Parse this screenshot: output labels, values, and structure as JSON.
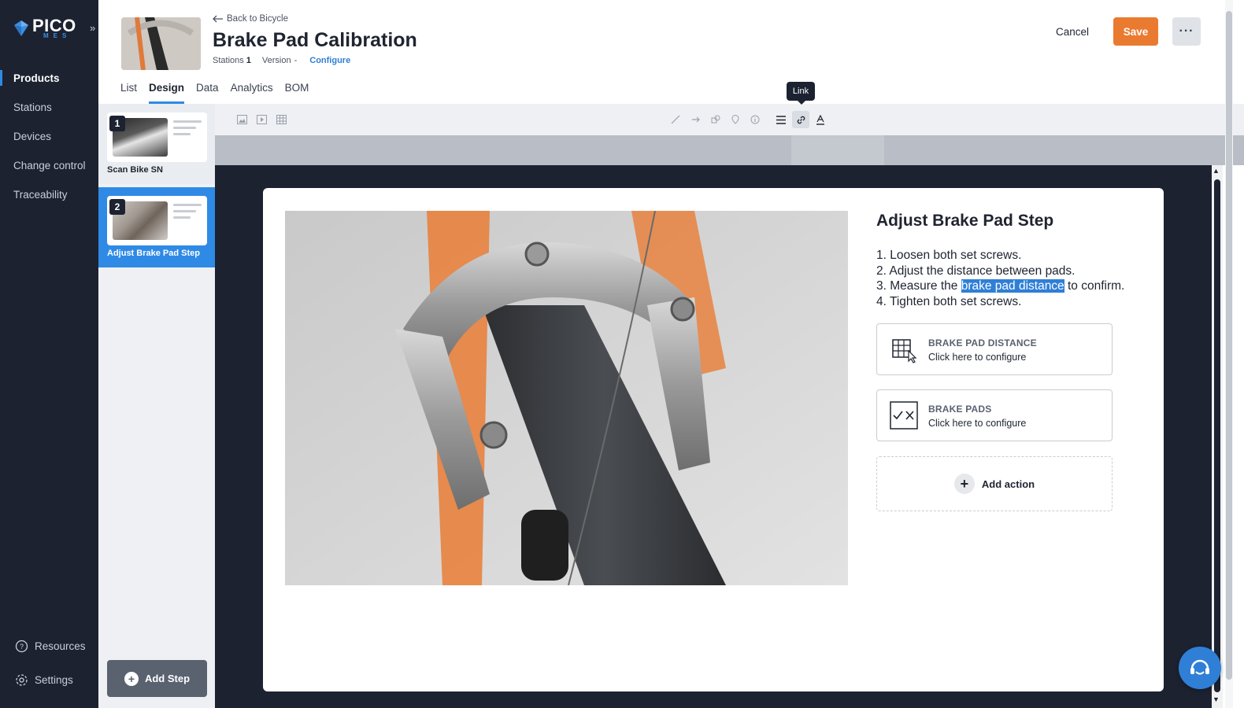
{
  "brand": {
    "name": "PICO",
    "sub": "MES",
    "accent": "#2f8ae6"
  },
  "sidebar": {
    "items": [
      {
        "label": "Products",
        "active": true
      },
      {
        "label": "Stations"
      },
      {
        "label": "Devices"
      },
      {
        "label": "Change control"
      },
      {
        "label": "Traceability"
      }
    ],
    "resources": "Resources",
    "settings": "Settings"
  },
  "header": {
    "back_label": "Back to Bicycle",
    "title": "Brake Pad Calibration",
    "stations_label": "Stations",
    "stations_value": "1",
    "version_label": "Version",
    "version_value": "-",
    "configure_label": "Configure",
    "cancel_label": "Cancel",
    "save_label": "Save",
    "more_label": "···"
  },
  "tabs": [
    "List",
    "Design",
    "Data",
    "Analytics",
    "BOM"
  ],
  "active_tab": "Design",
  "steps": [
    {
      "number": "1",
      "label": "Scan Bike SN"
    },
    {
      "number": "2",
      "label": "Adjust Brake Pad Step",
      "active": true
    }
  ],
  "add_step_label": "Add Step",
  "toolbar": {
    "tooltip": "Link",
    "icons": [
      "image-icon",
      "video-icon",
      "table-icon",
      "line-icon",
      "arrow-icon",
      "shape-icon",
      "marker-icon",
      "info-icon",
      "align-icon",
      "link-icon",
      "text-color-icon"
    ]
  },
  "content": {
    "step_title": "Adjust Brake Pad Step",
    "instructions": {
      "line1": "1. Loosen both set screws.",
      "line2": "2. Adjust the distance between pads.",
      "line3_pre": "3. Measure the ",
      "line3_sel": "brake pad distance",
      "line3_post": " to confirm.",
      "line4": "4. Tighten both set screws."
    },
    "actions": [
      {
        "title": "BRAKE PAD DISTANCE",
        "subtitle": "Click here to configure",
        "icon": "table-cursor-icon"
      },
      {
        "title": "BRAKE PADS",
        "subtitle": "Click here to configure",
        "icon": "check-cross-icon"
      }
    ],
    "add_action_label": "Add action"
  },
  "colors": {
    "save": "#ea7a2f",
    "sidebar": "#1c2230",
    "selection": "#2f7fd6"
  }
}
